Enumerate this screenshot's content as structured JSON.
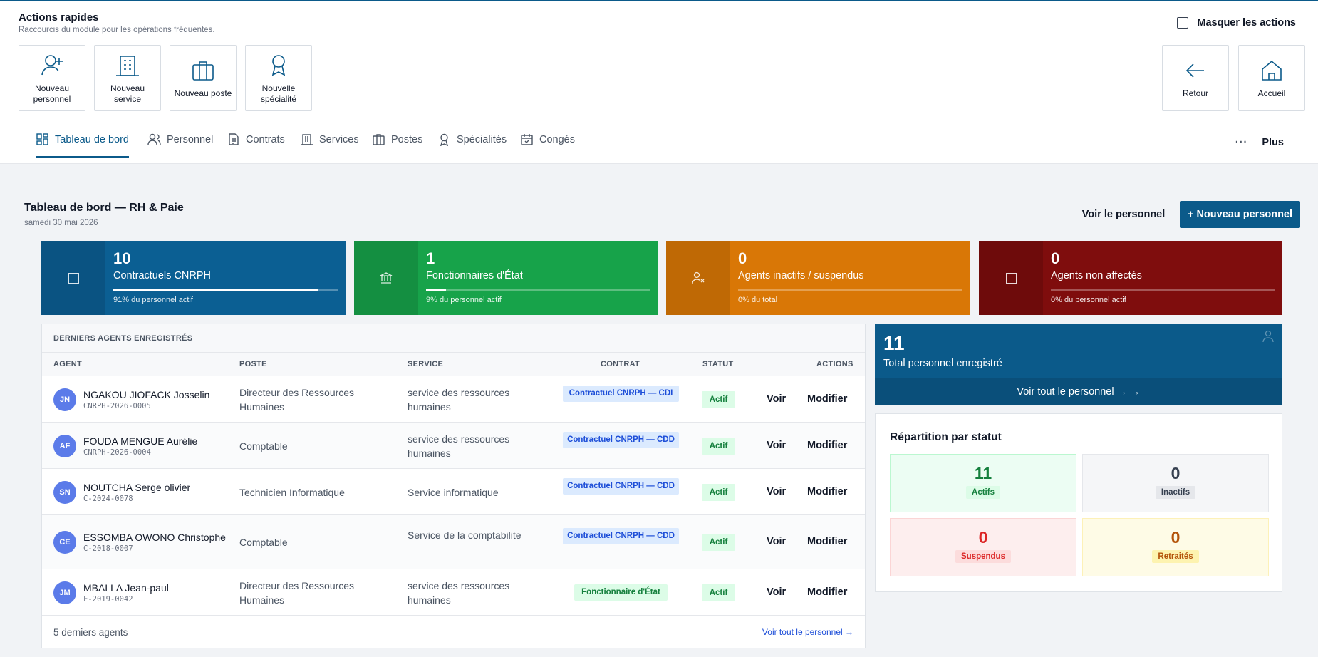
{
  "quick_actions": {
    "title": "Actions rapides",
    "subtitle": "Raccourcis du module pour les opérations fréquentes.",
    "hide_label": "Masquer les actions",
    "left": [
      {
        "label": "Nouveau personnel",
        "icon": "user-plus-icon"
      },
      {
        "label": "Nouveau service",
        "icon": "building-icon"
      },
      {
        "label": "Nouveau poste",
        "icon": "briefcase-icon"
      },
      {
        "label": "Nouvelle spécialité",
        "icon": "award-icon"
      }
    ],
    "right": [
      {
        "label": "Retour",
        "icon": "arrow-left-icon"
      },
      {
        "label": "Accueil",
        "icon": "home-icon"
      }
    ]
  },
  "nav": {
    "tabs": [
      {
        "label": "Tableau de bord",
        "icon": "dashboard-icon",
        "active": true
      },
      {
        "label": "Personnel",
        "icon": "users-icon"
      },
      {
        "label": "Contrats",
        "icon": "document-icon"
      },
      {
        "label": "Services",
        "icon": "building-icon"
      },
      {
        "label": "Postes",
        "icon": "briefcase-icon"
      },
      {
        "label": "Spécialités",
        "icon": "award-icon"
      },
      {
        "label": "Congés",
        "icon": "calendar-icon"
      }
    ],
    "more_dots": "···",
    "more_label": "Plus"
  },
  "header": {
    "title": "Tableau de bord — RH & Paie",
    "date": "samedi 30 mai 2026",
    "view_staff": "Voir le personnel",
    "new_staff": "+ Nouveau personnel"
  },
  "stats": [
    {
      "value": "10",
      "label": "Contractuels CNRPH",
      "progress": 0.91,
      "percent_text": "91% du personnel actif",
      "color": "#0b5f93",
      "icon_bg": "#0a5382",
      "icon": "square-icon"
    },
    {
      "value": "1",
      "label": "Fonctionnaires d'État",
      "progress": 0.09,
      "percent_text": "9% du personnel actif",
      "color": "#17a34a",
      "icon_bg": "#148f41",
      "icon": "bank-icon"
    },
    {
      "value": "0",
      "label": "Agents inactifs / suspendus",
      "progress": 0,
      "percent_text": "0% du total",
      "color": "#d97706",
      "icon_bg": "#bf6905",
      "icon": "user-x-icon"
    },
    {
      "value": "0",
      "label": "Agents non affectés",
      "progress": 0,
      "percent_text": "0% du personnel actif",
      "color": "#7f0d0d",
      "icon_bg": "#6e0b0b",
      "icon": "square-icon"
    }
  ],
  "table": {
    "title": "DERNIERS AGENTS ENREGISTRÉS",
    "columns": {
      "agent": "AGENT",
      "poste": "POSTE",
      "service": "SERVICE",
      "contrat": "CONTRAT",
      "statut": "STATUT",
      "actions": "ACTIONS"
    },
    "view_label": "Voir",
    "edit_label": "Modifier",
    "rows": [
      {
        "initials": "JN",
        "name": "NGAKOU JIOFACK Josselin",
        "id": "CNRPH-2026-0005",
        "poste": "Directeur des Ressources Humaines",
        "service": "service des ressources humaines",
        "contrat": "Contractuel CNRPH — CDI",
        "contract_type": "cnrph",
        "statut": "Actif"
      },
      {
        "initials": "AF",
        "name": "FOUDA MENGUE Aurélie",
        "id": "CNRPH-2026-0004",
        "poste": "Comptable",
        "service": "service des ressources humaines",
        "contrat": "Contractuel CNRPH — CDD",
        "contract_type": "cnrph",
        "statut": "Actif"
      },
      {
        "initials": "SN",
        "name": "NOUTCHA Serge olivier",
        "id": "C-2024-0078",
        "poste": "Technicien Informatique",
        "service": "Service informatique",
        "contrat": "Contractuel CNRPH — CDD",
        "contract_type": "cnrph",
        "statut": "Actif"
      },
      {
        "initials": "CE",
        "name": "ESSOMBA OWONO Christophe",
        "id": "C-2018-0007",
        "poste": "Comptable",
        "service": "Service de la comptabilite",
        "contrat": "Contractuel CNRPH — CDD",
        "contract_type": "cnrph",
        "statut": "Actif"
      },
      {
        "initials": "JM",
        "name": "MBALLA Jean-paul",
        "id": "F-2019-0042",
        "poste": "Directeur des Ressources Humaines",
        "service": "service des ressources humaines",
        "contrat": "Fonctionnaire d'État",
        "contract_type": "state",
        "statut": "Actif"
      }
    ],
    "footer_count": "5 derniers agents",
    "footer_link": "Voir tout le personnel →"
  },
  "total": {
    "value": "11",
    "label": "Total personnel enregistré",
    "link": "Voir tout le personnel → →",
    "icon": "users-icon"
  },
  "repartition": {
    "title": "Répartition par statut",
    "tiles": [
      {
        "value": "11",
        "label": "Actifs",
        "bg": "#ecfdf3",
        "border": "#bbf7d0",
        "color": "#15803d",
        "tag_bg": "#dcfce7"
      },
      {
        "value": "0",
        "label": "Inactifs",
        "bg": "#f5f6f8",
        "border": "#e5e7eb",
        "color": "#374151",
        "tag_bg": "#e5e7eb"
      },
      {
        "value": "0",
        "label": "Suspendus",
        "bg": "#fdeeee",
        "border": "#fbd5d5",
        "color": "#dc2626",
        "tag_bg": "#fcdcdc"
      },
      {
        "value": "0",
        "label": "Retraités",
        "bg": "#fefbe6",
        "border": "#fdf1b8",
        "color": "#b45309",
        "tag_bg": "#fdf3b0"
      }
    ]
  }
}
